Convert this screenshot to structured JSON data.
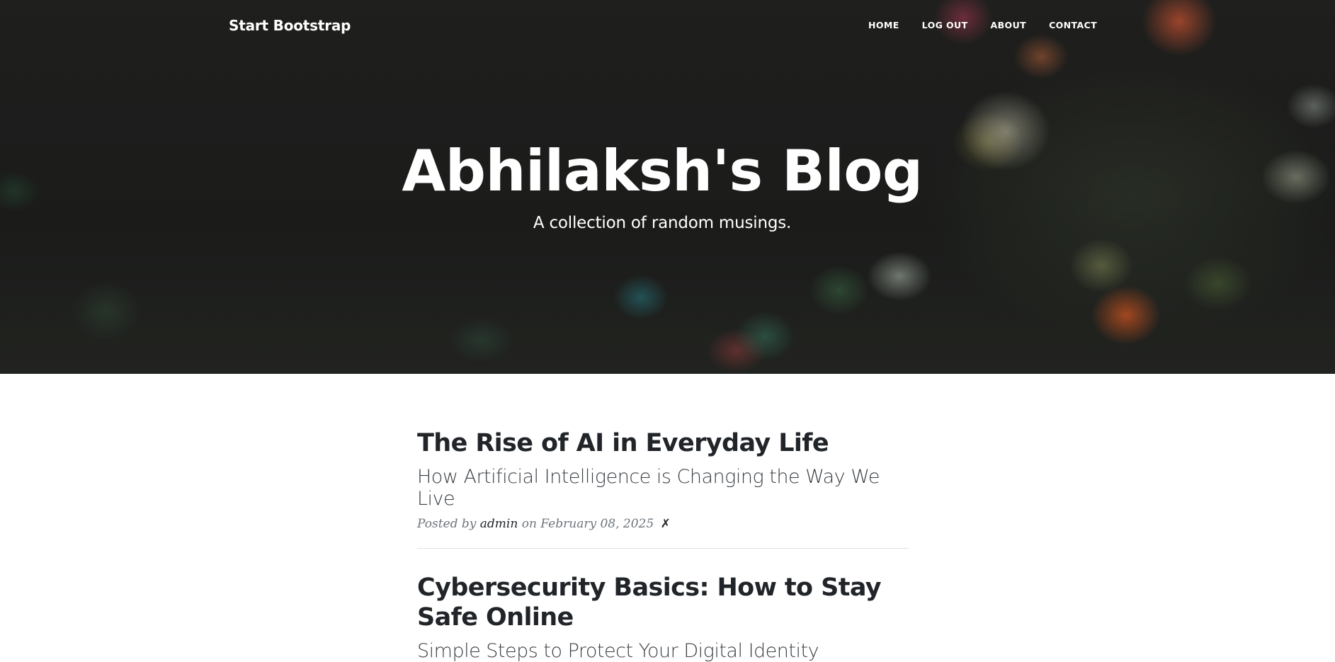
{
  "navbar": {
    "brand": "Start Bootstrap",
    "links": [
      "HOME",
      "LOG OUT",
      "ABOUT",
      "CONTACT"
    ]
  },
  "header": {
    "title": "Abhilaksh's Blog",
    "subtitle": "A collection of random musings."
  },
  "posts": [
    {
      "title": "The Rise of AI in Everyday Life",
      "subtitle": "How Artificial Intelligence is Changing the Way We Live",
      "meta_prefix": "Posted by",
      "author": "admin",
      "meta_on": "on February 08, 2025",
      "delete_glyph": "✗"
    },
    {
      "title": "Cybersecurity Basics: How to Stay Safe Online",
      "subtitle": "Simple Steps to Protect Your Digital Identity"
    }
  ]
}
